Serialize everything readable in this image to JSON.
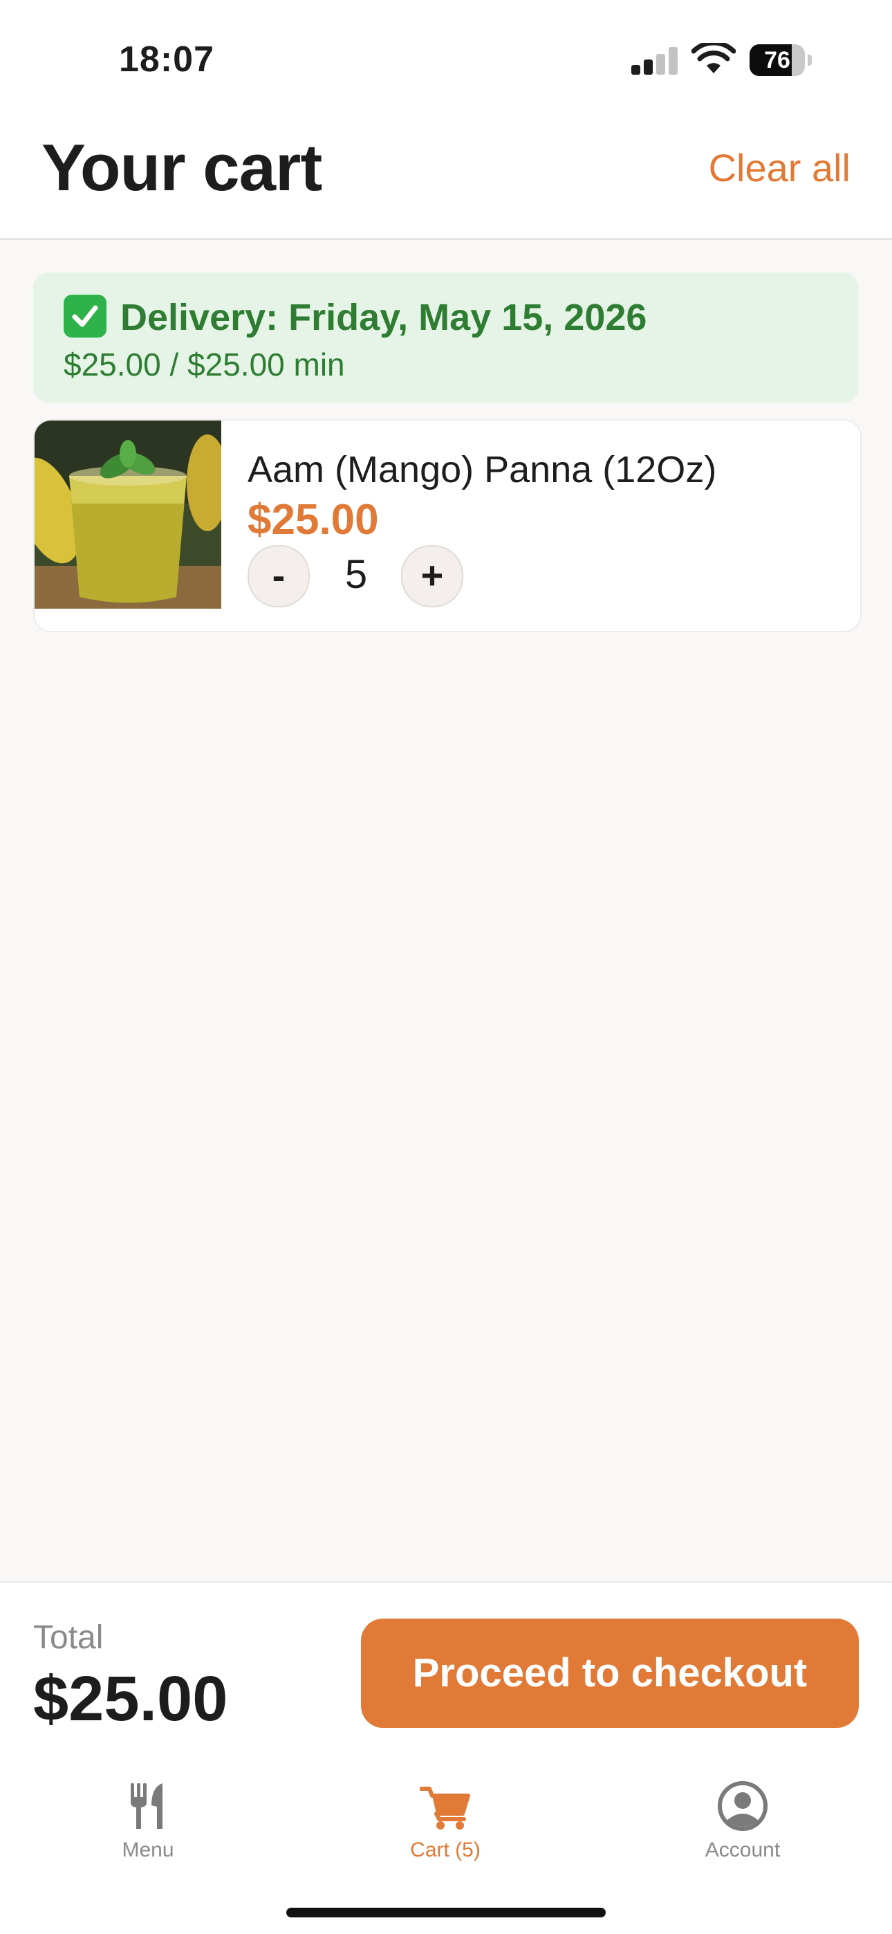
{
  "status_bar": {
    "time": "18:07",
    "battery_percent": "76",
    "battery_level": 0.76
  },
  "header": {
    "title": "Your cart",
    "clear_all_label": "Clear all"
  },
  "delivery": {
    "icon": "check-mark-icon",
    "title": "Delivery: Friday, May 15, 2026",
    "minimum": "$25.00 / $25.00 min"
  },
  "cart": {
    "items": [
      {
        "name": "Aam (Mango) Panna (12Oz)",
        "price": "$25.00",
        "quantity": "5",
        "minus_label": "-",
        "plus_label": "+",
        "image": "mango-drink-photo"
      }
    ]
  },
  "footer": {
    "total_label": "Total",
    "total_amount": "$25.00",
    "checkout_label": "Proceed to checkout"
  },
  "tabbar": {
    "menu_label": "Menu",
    "cart_label": "Cart (5)",
    "account_label": "Account"
  },
  "colors": {
    "accent": "#e07a36",
    "success_text": "#2e7d32",
    "success_bg": "#e6f4e8"
  }
}
